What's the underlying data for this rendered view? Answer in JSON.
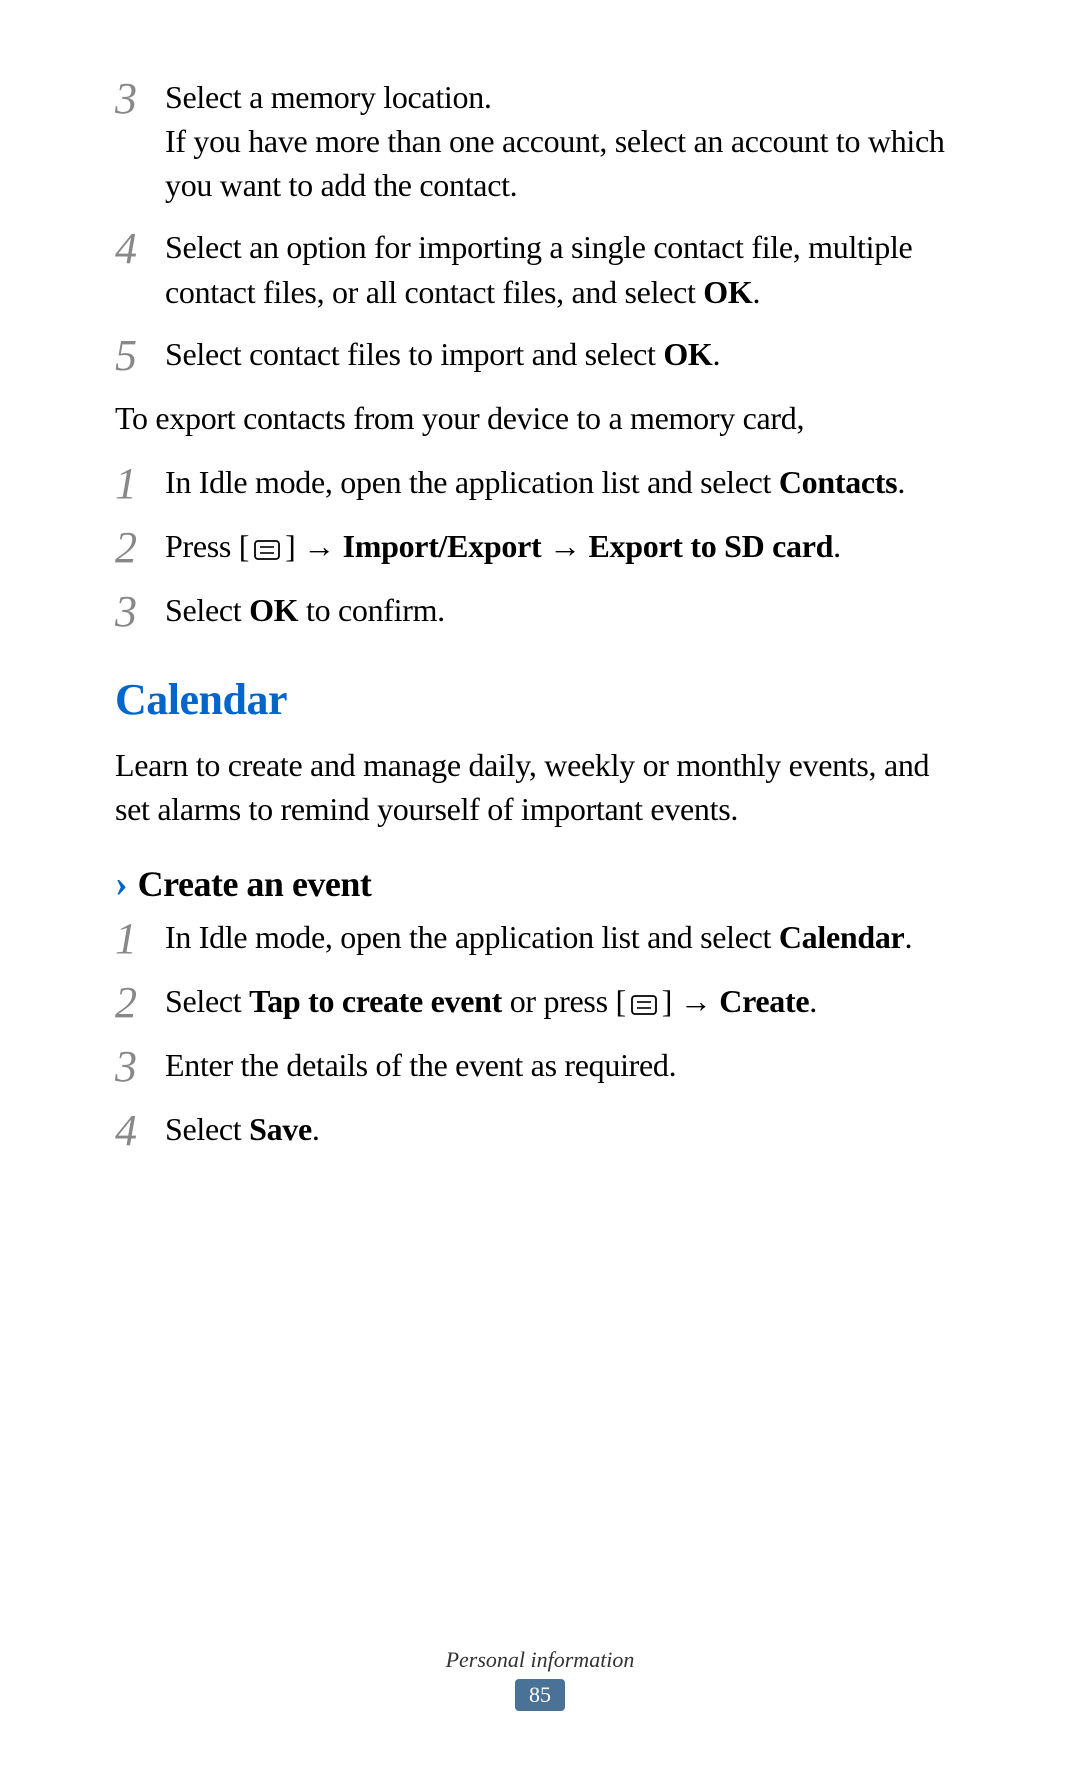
{
  "steps1": {
    "n3": "3",
    "t3a": "Select a memory location.",
    "t3b": "If you have more than one account, select an account to which you want to add the contact.",
    "n4": "4",
    "t4a": "Select an option for importing a single contact file, multiple contact files, or all contact files, and select ",
    "t4b": "OK",
    "t4c": ".",
    "n5": "5",
    "t5a": "Select contact files to import and select ",
    "t5b": "OK",
    "t5c": "."
  },
  "export_intro": "To export contacts from your device to a memory card,",
  "steps2": {
    "n1": "1",
    "t1a": "In Idle mode, open the application list and select ",
    "t1b": "Contacts",
    "t1c": ".",
    "n2": "2",
    "t2a": "Press [",
    "t2b": "] ",
    "t2arrow1": "→",
    "t2c": " Import/Export ",
    "t2arrow2": "→",
    "t2d": " Export to SD card",
    "t2e": ".",
    "n3": "3",
    "t3a": "Select ",
    "t3b": "OK",
    "t3c": " to confirm."
  },
  "calendar": {
    "title": "Calendar",
    "intro": "Learn to create and manage daily, weekly or monthly events, and set alarms to remind yourself of important events.",
    "subtitle": "Create an event"
  },
  "steps3": {
    "n1": "1",
    "t1a": "In Idle mode, open the application list and select ",
    "t1b": "Calendar",
    "t1c": ".",
    "n2": "2",
    "t2a": "Select ",
    "t2b": "Tap to create event",
    "t2c": " or press [",
    "t2d": "] ",
    "t2arrow": "→",
    "t2e": " Create",
    "t2f": ".",
    "n3": "3",
    "t3": "Enter the details of the event as required.",
    "n4": "4",
    "t4a": "Select ",
    "t4b": "Save",
    "t4c": "."
  },
  "footer": {
    "section": "Personal information",
    "page": "85"
  }
}
